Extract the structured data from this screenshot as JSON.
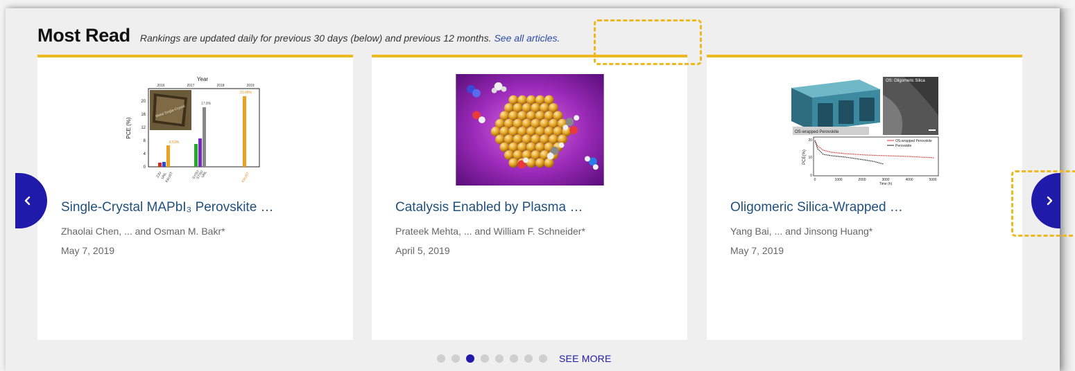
{
  "section": {
    "title": "Most Read",
    "subtitle": "Rankings are updated daily for previous 30 days (below) and previous 12 months.",
    "link": "See all articles."
  },
  "cards": [
    {
      "title": "Single-Crystal MAPbI₃ Perovskite …",
      "authors": "Zhaolai Chen, ... and Osman M. Bakr*",
      "date": "May 7, 2019",
      "thumb": {
        "year_label": "Year",
        "years": [
          "2016",
          "2017",
          "2018",
          "2019"
        ],
        "y_label": "PCE (%)",
        "y_ticks": [
          "20",
          "16",
          "12",
          "8",
          "4",
          "0"
        ],
        "bar_labels": [
          "6.53%",
          "17.8%",
          "21.09%"
        ],
        "inset_label": "Metal Single-Crystal",
        "x_labels": [
          "ZJU",
          "UNL",
          "KAUST",
          "SYSU",
          "STSU",
          "UNL",
          "KAUST"
        ]
      }
    },
    {
      "title": "Catalysis Enabled by Plasma …",
      "authors": "Prateek Mehta, ... and William F. Schneider*",
      "date": "April 5, 2019"
    },
    {
      "title": "Oligomeric Silica-Wrapped …",
      "authors": "Yang Bai, ... and Jinsong Huang*",
      "date": "May 7, 2019",
      "thumb": {
        "top_right_label": "OS: Oligomeric Silica",
        "left_label": "OS-wrapped Perovskite",
        "legend": [
          "OS-wrapped Perovskite",
          "Perovskite"
        ],
        "y_label": "PCE(%)",
        "y_ticks": [
          "20",
          "10",
          "0"
        ],
        "x_ticks": [
          "0",
          "1000",
          "2000",
          "3000",
          "4000",
          "5000"
        ],
        "x_label": "Time (h)"
      }
    }
  ],
  "pagination": {
    "dot_count": 8,
    "active_index": 2,
    "see_more": "SEE MORE"
  },
  "colors": {
    "accent_bar": "#f0b820",
    "nav": "#1f1aa9",
    "title_link": "#20517e"
  }
}
